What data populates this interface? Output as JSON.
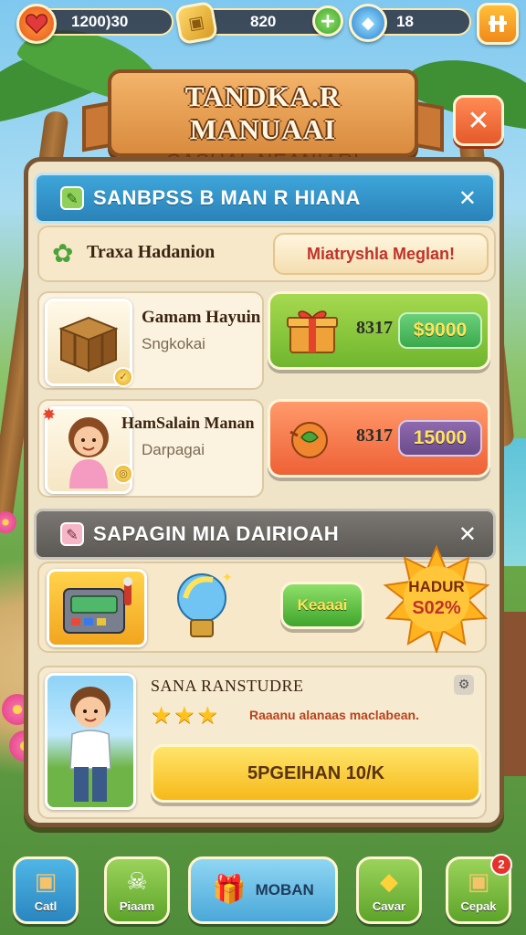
{
  "topbar": {
    "lives_value": "1200)30",
    "coins_value": "820",
    "gems_value": "18",
    "heart_icon": "heart-icon",
    "coin_icon": "gold-block-icon",
    "gem_icon": "blue-gem-icon",
    "add_icon": "plus-icon",
    "menu_icon": "menu-icon"
  },
  "banner": {
    "title": "TANDKA.R MANUAAI",
    "subtitle": "CASUAL NEANIARI"
  },
  "section1": {
    "title": "SANBPSS B MAN R HIANA",
    "close": "✕",
    "tab_label": "Traxa Hadanion",
    "tab_button": "Miatryshla Meglan!",
    "items": [
      {
        "name": "Gamam Hayuin",
        "desc": "Sngkokai",
        "code": "8317",
        "price": "$9000"
      },
      {
        "name": "HamSalain Manan",
        "desc": "Darpagai",
        "code": "8317",
        "price": "15000"
      }
    ]
  },
  "section2": {
    "title": "SAPAGIN MIA DAIRIOAH",
    "close": "✕",
    "action_button": "Keaaai",
    "badge_line1": "HADUR",
    "badge_line2": "S02%",
    "feature": {
      "name": "SANA RANSTUDRE",
      "stars": "★★★",
      "desc": "Raaanu alanaas maclabean.",
      "button": "5PGEIHAN 10/K"
    }
  },
  "nav": [
    {
      "label": "Catl",
      "icon": "crate-icon"
    },
    {
      "label": "Piaam",
      "icon": "skull-icon"
    },
    {
      "label": "MOBAN",
      "icon": "gift-icon"
    },
    {
      "label": "Cavar",
      "icon": "ticket-icon"
    },
    {
      "label": "Cepak",
      "icon": "box-icon",
      "badge": "2"
    }
  ],
  "colors": {
    "panel": "#efe3c8",
    "section1_header": "#2f8fc4",
    "section2_header": "#6b6865",
    "green_button": "#7cc23b",
    "orange_button": "#f36e3e",
    "price_green": "#46b75a",
    "price_purple": "#7a5b99"
  }
}
